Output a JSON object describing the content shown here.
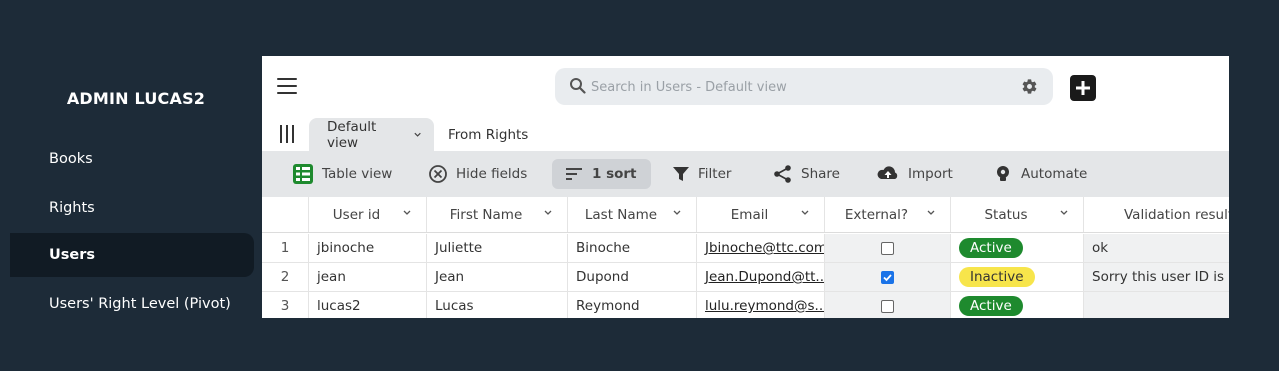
{
  "sidebar": {
    "brand": "ADMIN LUCAS2",
    "items": [
      {
        "label": "Books"
      },
      {
        "label": "Rights"
      },
      {
        "label": "Users"
      },
      {
        "label": "Users' Right Level (Pivot)"
      }
    ],
    "active_item": "Users"
  },
  "search": {
    "placeholder": "Search in Users - Default view"
  },
  "tabs": [
    {
      "label": "Default view"
    },
    {
      "label": "From Rights"
    }
  ],
  "toolbar": {
    "table_view": "Table view",
    "hide_fields": "Hide fields",
    "sort": "1 sort",
    "filter": "Filter",
    "share": "Share",
    "import": "Import",
    "automate": "Automate"
  },
  "table": {
    "columns": [
      "User id",
      "First Name",
      "Last Name",
      "Email",
      "External?",
      "Status",
      "Validation result"
    ],
    "rows": [
      {
        "num": "1",
        "user_id": "jbinoche",
        "first": "Juliette",
        "last": "Binoche",
        "email": "Jbinoche@ttc.com",
        "external": false,
        "status": "Active",
        "validation": "ok"
      },
      {
        "num": "2",
        "user_id": "jean",
        "first": "Jean",
        "last": "Dupond",
        "email": "Jean.Dupond@tt...",
        "external": true,
        "status": "Inactive",
        "validation": "Sorry this user ID is inva"
      },
      {
        "num": "3",
        "user_id": "lucas2",
        "first": "Lucas",
        "last": "Reymond",
        "email": "lulu.reymond@s...",
        "external": false,
        "status": "Active",
        "validation": ""
      }
    ]
  },
  "colors": {
    "background": "#1d2b38",
    "sidebar_active": "#111b24",
    "status_active": "#1e8a2e",
    "status_inactive": "#f7e54b",
    "table_view_icon": "#1e8a2e"
  }
}
